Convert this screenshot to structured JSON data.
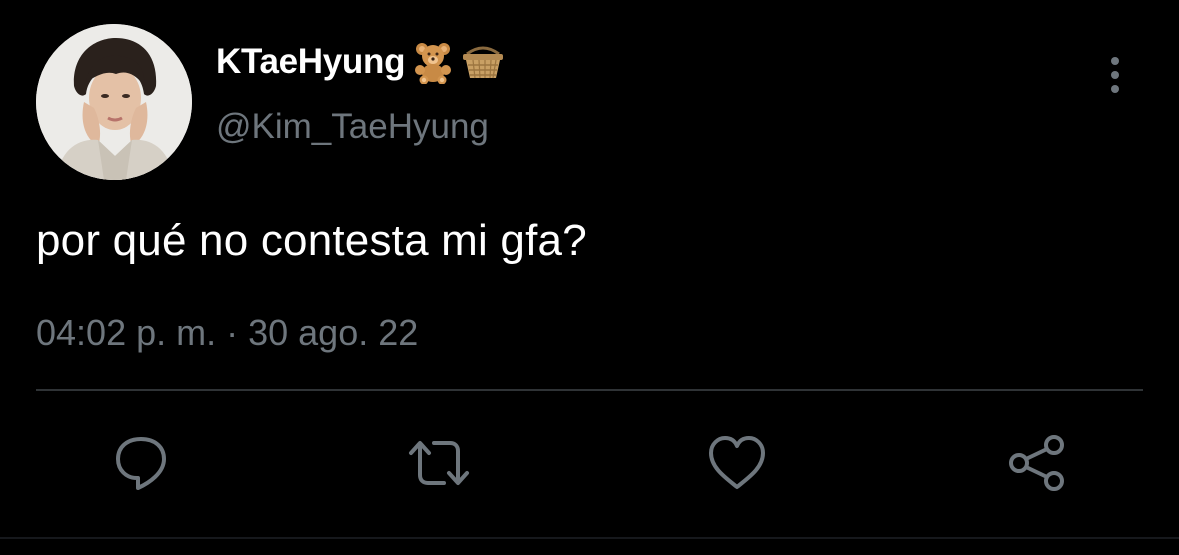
{
  "user": {
    "display_name": "KTaeHyung",
    "emojis": [
      "teddy-bear-emoji",
      "basket-emoji"
    ],
    "handle": "@Kim_TaeHyung"
  },
  "tweet": {
    "text": "por qué no contesta mi gfa?",
    "time": "04:02 p. m.",
    "separator": "·",
    "date": "30 ago. 22"
  },
  "actions": [
    "reply-icon",
    "retweet-icon",
    "like-icon",
    "share-icon"
  ],
  "colors": {
    "background": "#000000",
    "primary_text": "#ffffff",
    "secondary_text": "#6e767d",
    "divider": "#2f3336"
  }
}
